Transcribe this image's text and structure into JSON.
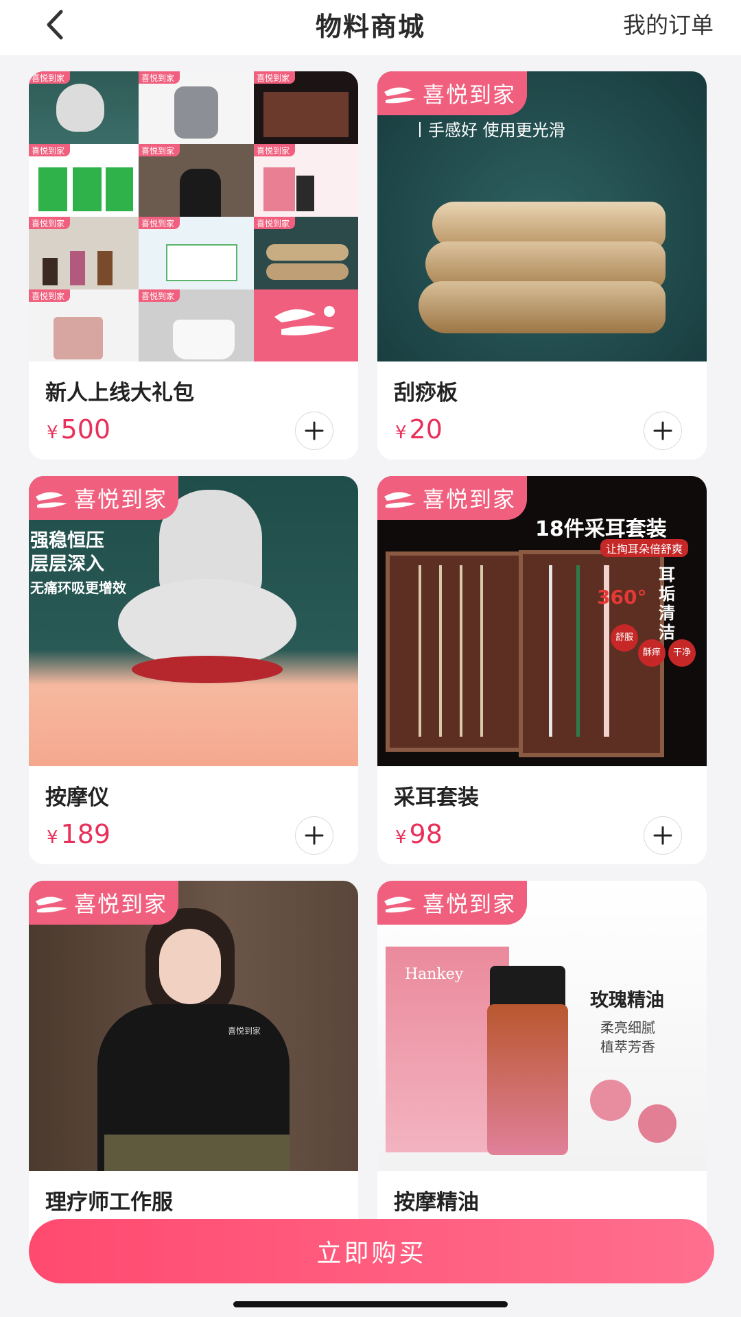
{
  "header": {
    "title": "物料商城",
    "orders_link": "我的订单"
  },
  "brand_tag": "喜悦到家",
  "price_prefix": "¥",
  "products": [
    {
      "name": "新人上线大礼包",
      "price": "500"
    },
    {
      "name": "刮痧板",
      "price": "20",
      "image_text": "丨手感好 使用更光滑"
    },
    {
      "name": "按摩仪",
      "price": "189",
      "image_text": [
        "强稳恒压",
        "层层深入",
        "无痛环吸更增效"
      ]
    },
    {
      "name": "采耳套装",
      "price": "98",
      "image_text": [
        "18件采耳套装",
        "让掏耳朵倍舒爽",
        "360°",
        "耳垢清洁",
        "舒服",
        "酥痒",
        "干净"
      ]
    },
    {
      "name": "理疗师工作服",
      "image_text": "喜悦到家"
    },
    {
      "name": "按摩精油",
      "image_text": [
        "Hankey",
        "玫瑰精油",
        "柔亮细腻",
        "植萃芳香"
      ]
    }
  ],
  "buy_button": "立即购买",
  "colors": {
    "accent": "#f0607e",
    "price": "#e8305a",
    "buy_gradient_start": "#ff4a6f",
    "buy_gradient_end": "#ff6f8e"
  }
}
